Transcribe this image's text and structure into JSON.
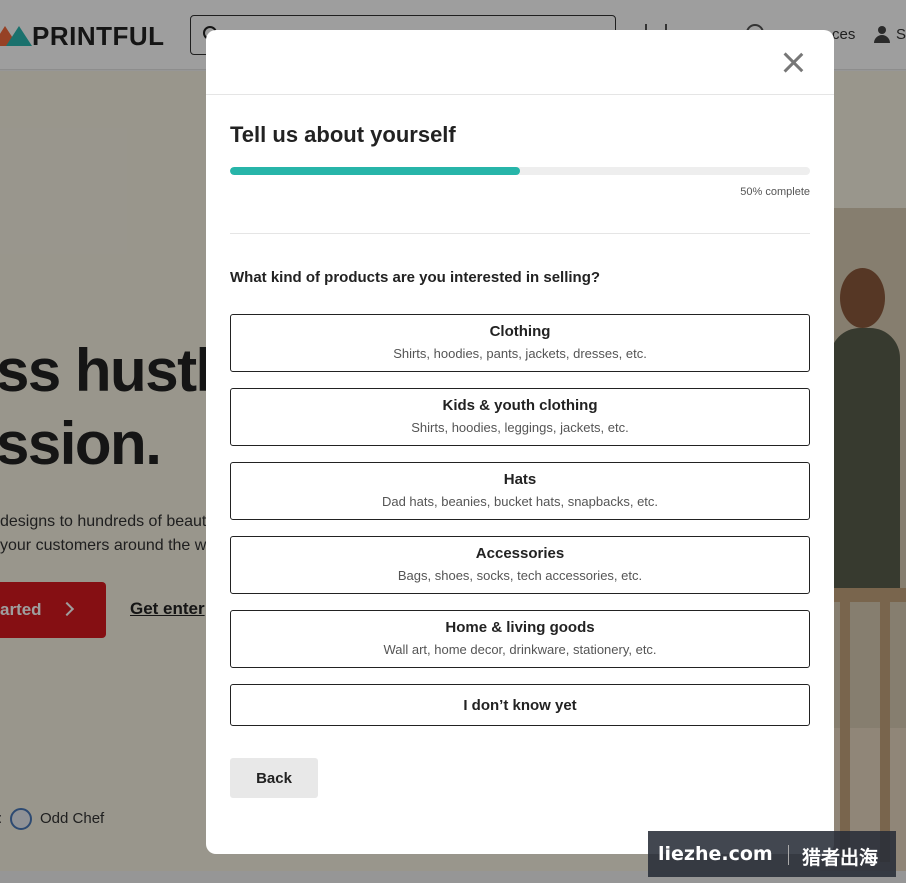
{
  "background": {
    "logo_text": "PRINTFUL",
    "nav_prices": "ces",
    "nav_signin": "S",
    "hero_line1": "ss hustl",
    "hero_line2": "ssion.",
    "hero_sub1": "designs to hundreds of beautif",
    "hero_sub2": " your customers around the w",
    "cta_primary": "arted",
    "cta_secondary": "Get enter",
    "brand_prefix": ":",
    "brand_name": "Odd Chef"
  },
  "modal": {
    "title": "Tell us about yourself",
    "progress_fraction": 0.5,
    "progress_text": "50% complete",
    "question": "What kind of products are you interested in selling?",
    "options": [
      {
        "title": "Clothing",
        "subtitle": "Shirts, hoodies, pants, jackets, dresses, etc."
      },
      {
        "title": "Kids & youth clothing",
        "subtitle": "Shirts, hoodies, leggings, jackets, etc."
      },
      {
        "title": "Hats",
        "subtitle": "Dad hats, beanies, bucket hats, snapbacks, etc."
      },
      {
        "title": "Accessories",
        "subtitle": "Bags, shoes, socks, tech accessories, etc."
      },
      {
        "title": "Home & living goods",
        "subtitle": "Wall art, home decor, drinkware, stationery, etc."
      },
      {
        "title": "I don’t know yet",
        "subtitle": ""
      }
    ],
    "back_label": "Back"
  },
  "watermark": {
    "left": "liezhe.com",
    "right": "猎者出海"
  },
  "colors": {
    "progress": "#27b5a9",
    "cta": "#d71920",
    "overlay": "rgba(0,0,0,0.38)"
  }
}
